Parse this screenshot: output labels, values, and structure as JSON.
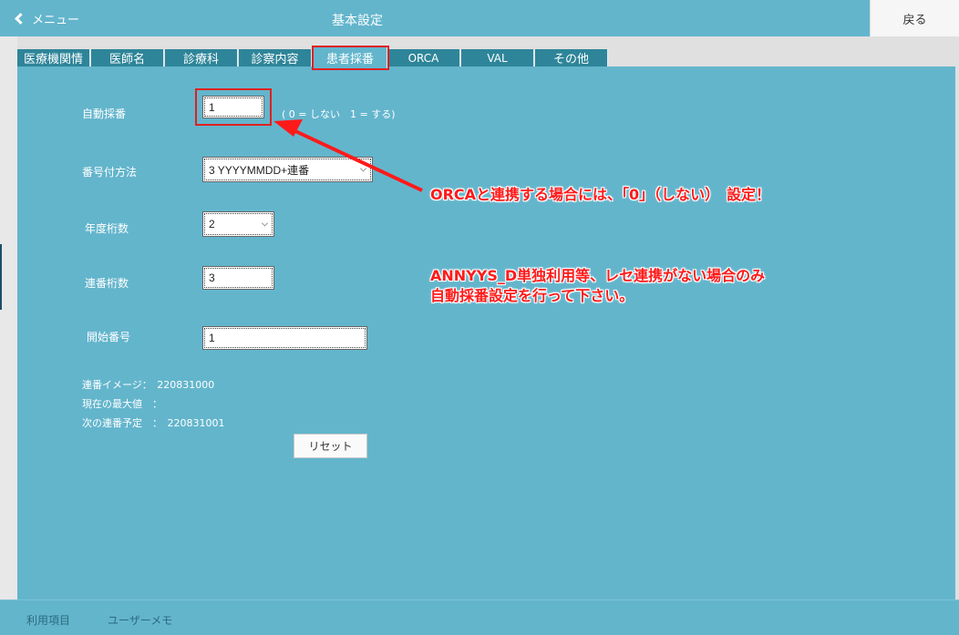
{
  "header": {
    "menu_label": "メニュー",
    "title": "基本設定",
    "back_label": "戻る"
  },
  "tabs": [
    {
      "label": "医療機関情"
    },
    {
      "label": "医師名"
    },
    {
      "label": "診療科"
    },
    {
      "label": "診察内容"
    },
    {
      "label": "患者採番"
    },
    {
      "label": "ORCA"
    },
    {
      "label": "VAL"
    },
    {
      "label": "その他"
    }
  ],
  "form": {
    "auto_number": {
      "label": "自動採番",
      "value": "1",
      "hint": "( 0 = しない　1 = する)"
    },
    "numbering_method": {
      "label": "番号付方法",
      "value": "3 YYYYMMDD+連番"
    },
    "year_digits": {
      "label": "年度桁数",
      "value": "2"
    },
    "serial_digits": {
      "label": "連番桁数",
      "value": "3"
    },
    "start_number": {
      "label": "開始番号",
      "value": "1"
    }
  },
  "info": {
    "serial_image": "連番イメージ：　220831000",
    "current_max": "現在の最大値　：",
    "next_serial": "次の連番予定　：　220831001"
  },
  "reset_label": "リセット",
  "annotations": {
    "line1": "ORCAと連携する場合には、「0」（しない）　設定！",
    "line2": "ANNYYS_D単独利用等、レセ連携がない場合のみ",
    "line3": "自動採番設定を行って下さい。"
  },
  "footer": {
    "item1": "利用項目",
    "item2": "ユーザーメモ"
  },
  "colors": {
    "panel": "#63b5cc",
    "tab": "#2e8599",
    "highlight": "#e02020",
    "annotation": "#ff1a1a"
  }
}
